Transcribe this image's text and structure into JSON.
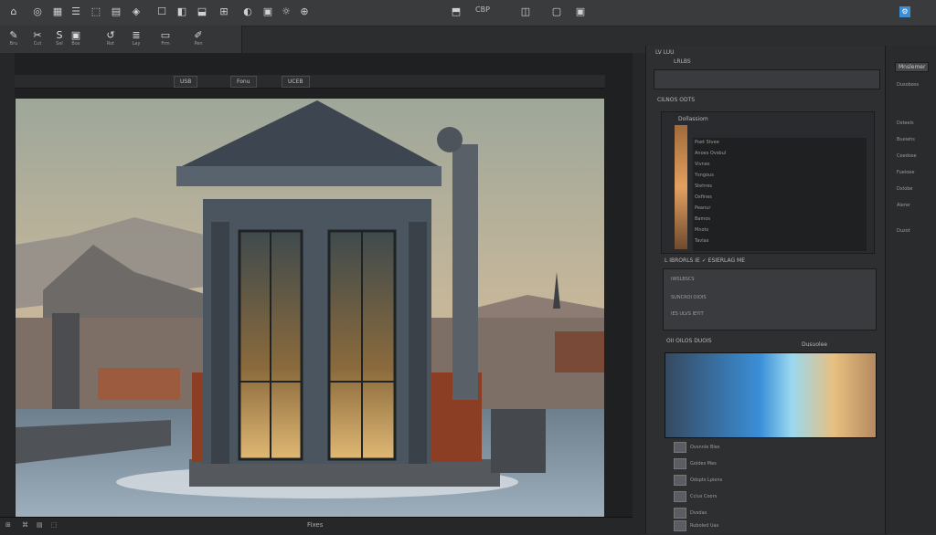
{
  "topbar": {
    "icons": [
      "⌂",
      "◎",
      "▦",
      "☰",
      "⬚",
      "▤",
      "◈",
      "☐",
      "◧",
      "⬓",
      "⊞",
      "◐",
      "▣",
      "☼",
      "⊕"
    ],
    "center_label": "CBP",
    "right_icons": [
      "⬒",
      "◫",
      "▢",
      "▣",
      "⚙"
    ]
  },
  "toolbar": {
    "tools": [
      {
        "icon": "✎",
        "label": "Bru"
      },
      {
        "icon": "✂",
        "label": "Cut"
      },
      {
        "icon": "S",
        "label": "Sel"
      },
      {
        "icon": "▣",
        "label": "Box"
      },
      {
        "icon": "↺",
        "label": "Rot"
      },
      {
        "icon": "≣",
        "label": "Lay"
      },
      {
        "icon": "▭",
        "label": "Frm"
      },
      {
        "icon": "✐",
        "label": "Pen"
      }
    ]
  },
  "document": {
    "tabs": [
      "USB",
      "Fonu",
      "UCEB"
    ],
    "status": [
      "⊞",
      "⌘",
      "▤",
      "⬚",
      "Fixes"
    ]
  },
  "right_panel": {
    "header": "LV LUU",
    "section1": "LRLBS",
    "section1_sub": "CILNOS ODTS",
    "layers_title": "Dollassiom",
    "layer_rows": [
      "Poet Stvee",
      "Anoes Ovsbul",
      "Vivnes",
      "Ysngous",
      "Stehres",
      "Oxfines",
      "Peanur",
      "Bamos",
      "Mnots",
      "Tavlas"
    ],
    "props_title": "L IBRORLS IE ✓ ESIERLAG ME",
    "props_rows": [
      "IWSLBSCS",
      "SUNCROI OIOIS",
      "IES ULVS IEYIT"
    ],
    "gradient_title": "OII OILOS DUOIS",
    "gradient_right": "Dusuolee",
    "list_rows": [
      "Ovsnnle Bles",
      "Goldes Mes",
      "Odspts Lpiens",
      "Cclus Coors",
      "Dvsdas",
      "Ruboled Uas"
    ]
  },
  "far_panel": {
    "tab": "Mnslemer",
    "items": [
      "Dusobess",
      "Dsteels",
      "Bueiehs",
      "Ceedose",
      "Fueioee",
      "Dxlobe",
      "Alerer",
      "Duzot"
    ]
  },
  "colors": {
    "accent": "#3a8fd8",
    "panel": "#2e2f31"
  }
}
